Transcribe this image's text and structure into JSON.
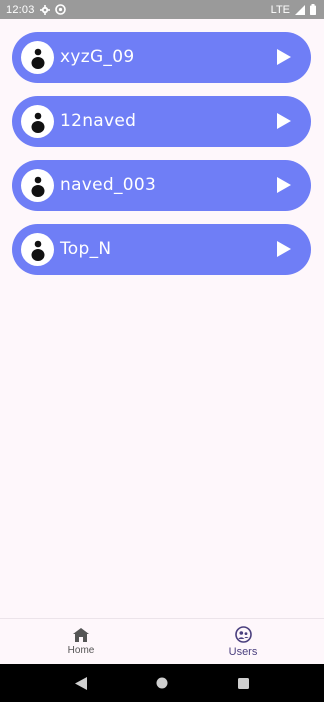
{
  "status_bar": {
    "time": "12:03",
    "network": "LTE",
    "icons": [
      "gear-icon",
      "settings-cog-icon",
      "signal-icon",
      "battery-icon"
    ]
  },
  "users": [
    {
      "name": "xyzG_09"
    },
    {
      "name": "12naved"
    },
    {
      "name": "naved_003"
    },
    {
      "name": "Top_N"
    }
  ],
  "bottom_nav": {
    "items": [
      {
        "label": "Home",
        "icon": "home-icon",
        "active": false
      },
      {
        "label": "Users",
        "icon": "users-icon",
        "active": true
      }
    ]
  },
  "colors": {
    "accent": "#6f7ef6",
    "background": "#fef7fb",
    "status_bar": "#9a9a9a"
  }
}
